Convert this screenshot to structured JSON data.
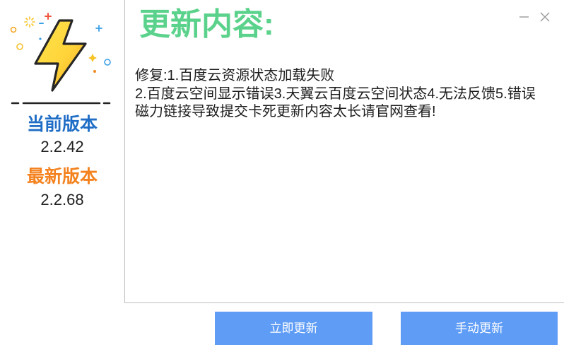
{
  "window_controls": {
    "minimize_icon": "minimize-icon",
    "close_icon": "close-icon"
  },
  "sidebar": {
    "logo_icon": "lightning-icon",
    "current_version_label": "当前版本",
    "current_version": "2.2.42",
    "latest_version_label": "最新版本",
    "latest_version": "2.2.68"
  },
  "main": {
    "title": "更新内容:",
    "content_lines": [
      "修复:1.百度云资源状态加载失败",
      "2.百度云空间显示错误3.天翼云百度云空间状态4.无法反馈5.错误",
      "磁力链接导致提交卡死更新内容太长请官网查看!"
    ]
  },
  "actions": {
    "update_now_label": "立即更新",
    "manual_update_label": "手动更新"
  },
  "colors": {
    "title": "#5bd28b",
    "current_version": "#1f6dc6",
    "latest_version": "#f4821e",
    "button": "#5e9cf6"
  }
}
